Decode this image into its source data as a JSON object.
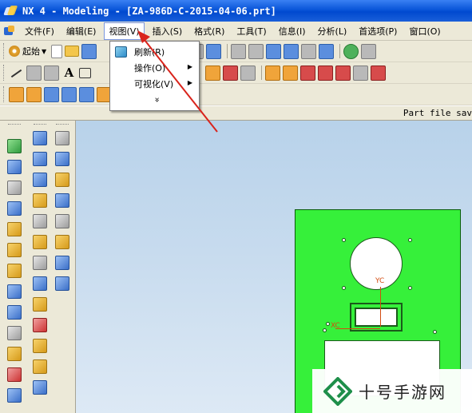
{
  "window": {
    "title": "NX 4 - Modeling - [ZA-986D-C-2015-04-06.prt]"
  },
  "menubar": {
    "items": [
      {
        "label": "文件(F)"
      },
      {
        "label": "编辑(E)"
      },
      {
        "label": "视图(V)",
        "active": true
      },
      {
        "label": "插入(S)"
      },
      {
        "label": "格式(R)"
      },
      {
        "label": "工具(T)"
      },
      {
        "label": "信息(I)"
      },
      {
        "label": "分析(L)"
      },
      {
        "label": "首选项(P)"
      },
      {
        "label": "窗口(O)"
      }
    ]
  },
  "toolbar": {
    "start_label": "起始"
  },
  "view_menu": {
    "items": [
      {
        "label": "刷新(R)",
        "has_submenu": false,
        "icon": "refresh-icon"
      },
      {
        "label": "操作(O)",
        "has_submenu": true
      },
      {
        "label": "可视化(V)",
        "has_submenu": true
      }
    ],
    "more_label": "»"
  },
  "status": {
    "text": "Part file sav"
  },
  "viewport": {
    "axis_label": "YC",
    "axis_label_x": "XC"
  },
  "watermark": {
    "text": "十号手游网"
  },
  "colors": {
    "title_bar": "#0a55d8",
    "part_fill": "#36f03a",
    "annotation_arrow": "#d9241c",
    "viewport_bg": "#c7dbee"
  }
}
